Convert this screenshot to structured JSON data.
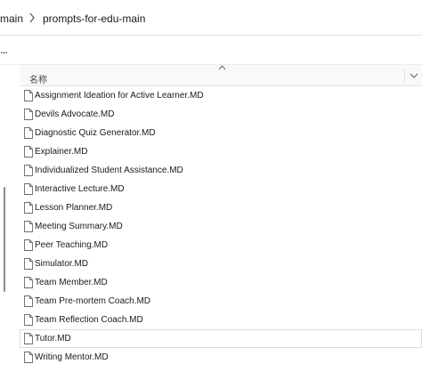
{
  "breadcrumb": {
    "items": [
      "main",
      "prompts-for-edu-main"
    ]
  },
  "toolbar": {
    "more_label": "..."
  },
  "header": {
    "name_column": "名称"
  },
  "files": [
    "Assignment Ideation for Active Learner.MD",
    "Devils Advocate.MD",
    "Diagnostic Quiz Generator.MD",
    "Explainer.MD",
    "Individualized Student Assistance.MD",
    "Interactive Lecture.MD",
    "Lesson Planner.MD",
    "Meeting Summary.MD",
    "Peer Teaching.MD",
    "Simulator.MD",
    "Team Member.MD",
    "Team Pre-mortem Coach.MD",
    "Team Reflection Coach.MD",
    "Tutor.MD",
    "Writing Mentor.MD"
  ],
  "selected_file_index": 13,
  "colors": {
    "header_bg": "#f7f9fb",
    "selection_border": "#cfe0f3"
  },
  "icons": {
    "breadcrumb_separator": "chevron-right-icon",
    "file": "file-icon",
    "sort": "sort-ascending-icon",
    "column_menu": "chevron-down-icon"
  }
}
